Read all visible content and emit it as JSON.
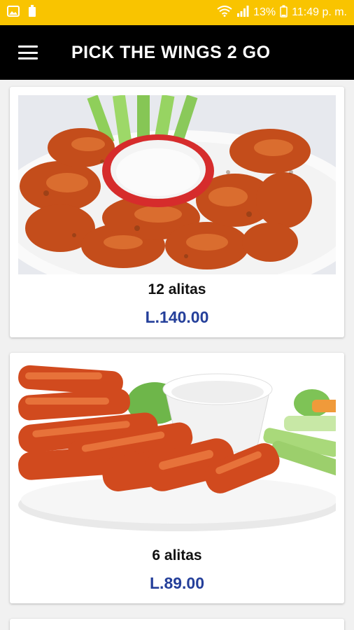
{
  "status_bar": {
    "battery": "13%",
    "time": "11:49 p. m.",
    "background": "#f9c400"
  },
  "app_bar": {
    "title": "PICK THE WINGS 2 GO",
    "menu_icon": "hamburger-menu-icon"
  },
  "products": [
    {
      "name": "12 alitas",
      "price": "L.140.00"
    },
    {
      "name": "6 alitas",
      "price": "L.89.00"
    }
  ],
  "colors": {
    "app_bar": "#000000",
    "price": "#243f9a",
    "background": "#f1f1f1"
  }
}
